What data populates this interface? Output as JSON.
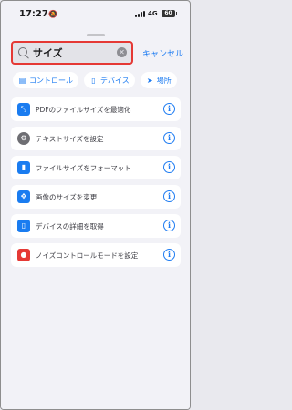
{
  "status_bar": {
    "time": "17:27",
    "network": "4G",
    "battery": "60"
  },
  "search": {
    "value": "サイズ",
    "cancel_label": "キャンセル"
  },
  "chips": [
    {
      "label": "コントロール",
      "icon": "toggle-icon"
    },
    {
      "label": "デバイス",
      "icon": "phone-icon"
    },
    {
      "label": "場所",
      "icon": "location-arrow-icon"
    }
  ],
  "results": [
    {
      "label": "PDFのファイルサイズを最適化",
      "icon": "compress-arrows-icon"
    },
    {
      "label": "テキストサイズを設定",
      "icon": "settings-gear-icon"
    },
    {
      "label": "ファイルサイズをフォーマット",
      "icon": "file-icon"
    },
    {
      "label": "画像のサイズを変更",
      "icon": "resize-arrows-icon"
    },
    {
      "label": "デバイスの詳細を取得",
      "icon": "device-icon"
    },
    {
      "label": "ノイズコントロールモードを設定",
      "icon": "noise-control-icon"
    }
  ],
  "colors": {
    "accent": "#1e7cf2",
    "highlight_border": "#e53935",
    "background": "#f2f2f7"
  }
}
